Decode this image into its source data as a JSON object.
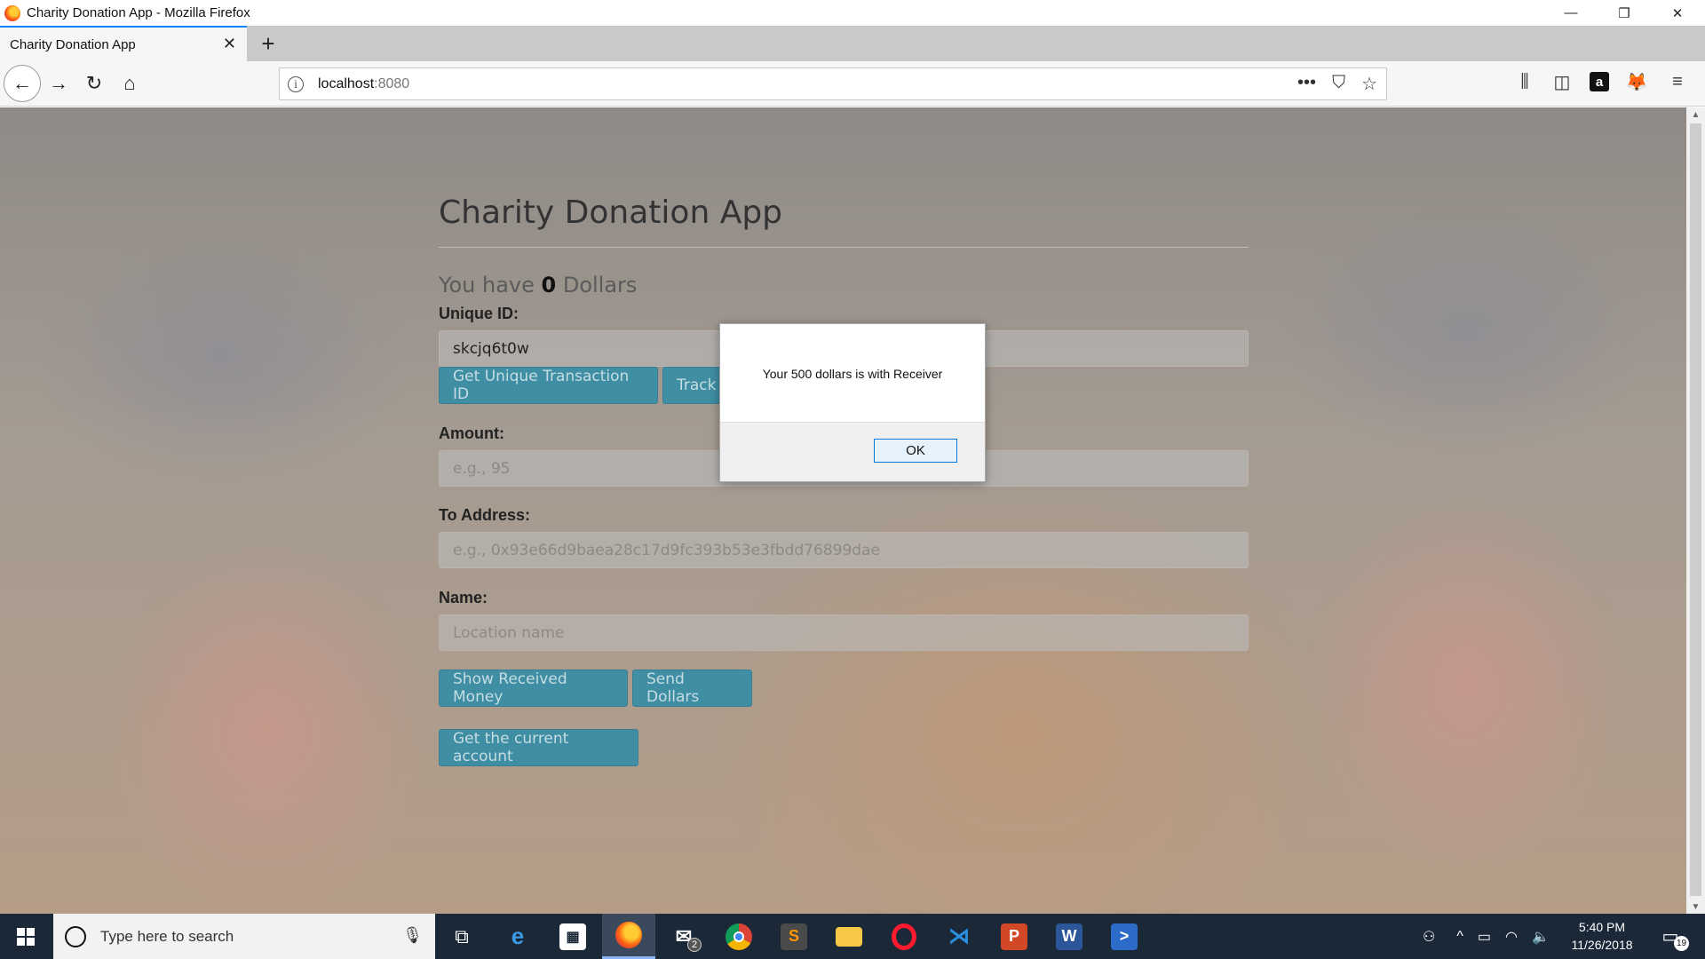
{
  "window": {
    "title": "Charity Donation App - Mozilla Firefox",
    "controls": {
      "minimize": "—",
      "restore": "❐",
      "close": "✕"
    }
  },
  "tabs": [
    {
      "label": "Charity Donation App",
      "close": "✕"
    }
  ],
  "new_tab": "+",
  "navigation": {
    "back": "←",
    "forward": "→",
    "reload": "↻",
    "home": "⌂",
    "url_host": "localhost",
    "url_port": ":8080",
    "url_actions": {
      "more": "•••",
      "pocket": "⛉",
      "bookmark": "☆"
    },
    "toolbar": {
      "library": "⫼",
      "sidebar": "◫",
      "amazon": "a",
      "metamask": "🦊",
      "menu": "≡"
    }
  },
  "app": {
    "title": "Charity Donation App",
    "balance": {
      "prefix": "You have ",
      "amount": "0",
      "suffix": " Dollars"
    },
    "unique_id": {
      "label": "Unique ID:",
      "value": "skcjq6t0w"
    },
    "get_unique_id_button": "Get Unique Transaction ID",
    "track_button": "Track",
    "amount": {
      "label": "Amount:",
      "placeholder": "e.g., 95"
    },
    "to_address": {
      "label": "To Address:",
      "placeholder": "e.g., 0x93e66d9baea28c17d9fc393b53e3fbdd76899dae"
    },
    "name": {
      "label": "Name:",
      "placeholder": "Location name"
    },
    "show_received_button": "Show Received Money",
    "send_dollars_button": "Send Dollars",
    "get_account_button": "Get the current account"
  },
  "dialog": {
    "message": "Your 500 dollars is with Receiver",
    "ok_label": "OK"
  },
  "taskbar": {
    "search_placeholder": "Type here to search",
    "mail_badge": "2",
    "time": "5:40 PM",
    "date": "11/26/2018",
    "notifications_count": "19"
  }
}
